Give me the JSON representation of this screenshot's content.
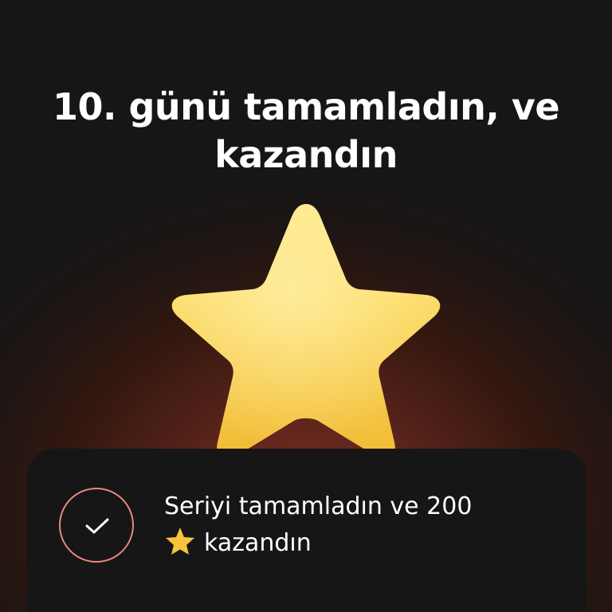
{
  "header": {
    "title_line1": "10. günü tamamladın, ve",
    "title_line2": "kazandın"
  },
  "hero": {
    "icon": "star-icon",
    "color": "#f7c948"
  },
  "toast": {
    "status_icon": "checkmark-icon",
    "message_line1": "Seriyi tamamladın ve 200",
    "message_line2": "kazandın",
    "inline_icon": "star-icon",
    "accent_color": "#e9897c"
  }
}
